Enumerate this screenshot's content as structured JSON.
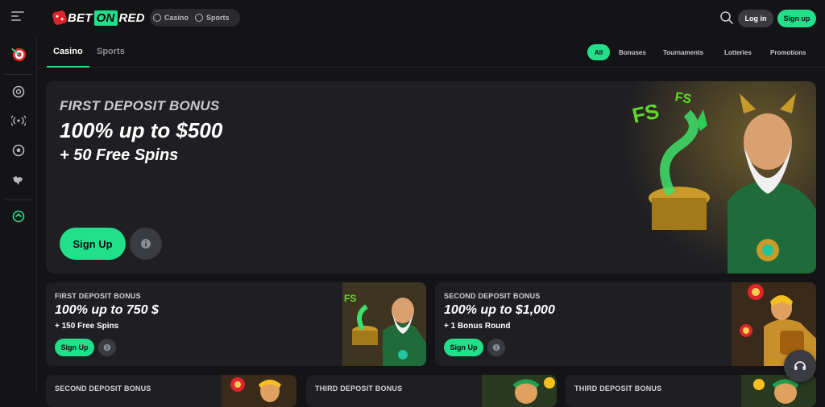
{
  "header": {
    "logo_text": "BET ON RED",
    "logo_bet": "BET",
    "logo_on": "ON",
    "logo_red": "RED",
    "mode_casino": "Casino",
    "mode_sports": "Sports",
    "login_label": "Log in",
    "signup_label": "Sign up"
  },
  "sidebar": {
    "items": [
      {
        "icon": "dart-target-icon"
      },
      {
        "icon": "casino-chip-icon"
      },
      {
        "icon": "live-broadcast-icon"
      },
      {
        "icon": "soccer-ball-icon"
      },
      {
        "icon": "world-map-icon"
      },
      {
        "icon": "support-agent-icon"
      }
    ]
  },
  "tabs": {
    "casino": "Casino",
    "sports": "Sports"
  },
  "filters": {
    "all": "All",
    "bonuses": "Bonuses",
    "tournaments": "Tournaments",
    "lotteries": "Lotteries",
    "promotions": "Promotions"
  },
  "hero": {
    "eyebrow": "FIRST DEPOSIT BONUS",
    "headline": "100% up to $500",
    "subline": "+ 50 Free Spins",
    "cta": "Sign Up",
    "art_badge": "FS"
  },
  "cards": [
    {
      "eyebrow": "FIRST DEPOSIT BONUS",
      "headline": "100% up to 750 $",
      "subline": "+ 150 Free Spins",
      "cta": "Sign Up"
    },
    {
      "eyebrow": "SECOND DEPOSIT BONUS",
      "headline": "100% up to $1,000",
      "subline": "+ 1 Bonus Round",
      "cta": "Sign Up"
    },
    {
      "eyebrow": "SECOND DEPOSIT BONUS"
    },
    {
      "eyebrow": "THIRD DEPOSIT BONUS"
    },
    {
      "eyebrow": "THIRD DEPOSIT BONUS"
    }
  ],
  "colors": {
    "accent": "#22e08a",
    "brand_red": "#e0242b",
    "background": "#141416",
    "card": "#1f1f23"
  }
}
